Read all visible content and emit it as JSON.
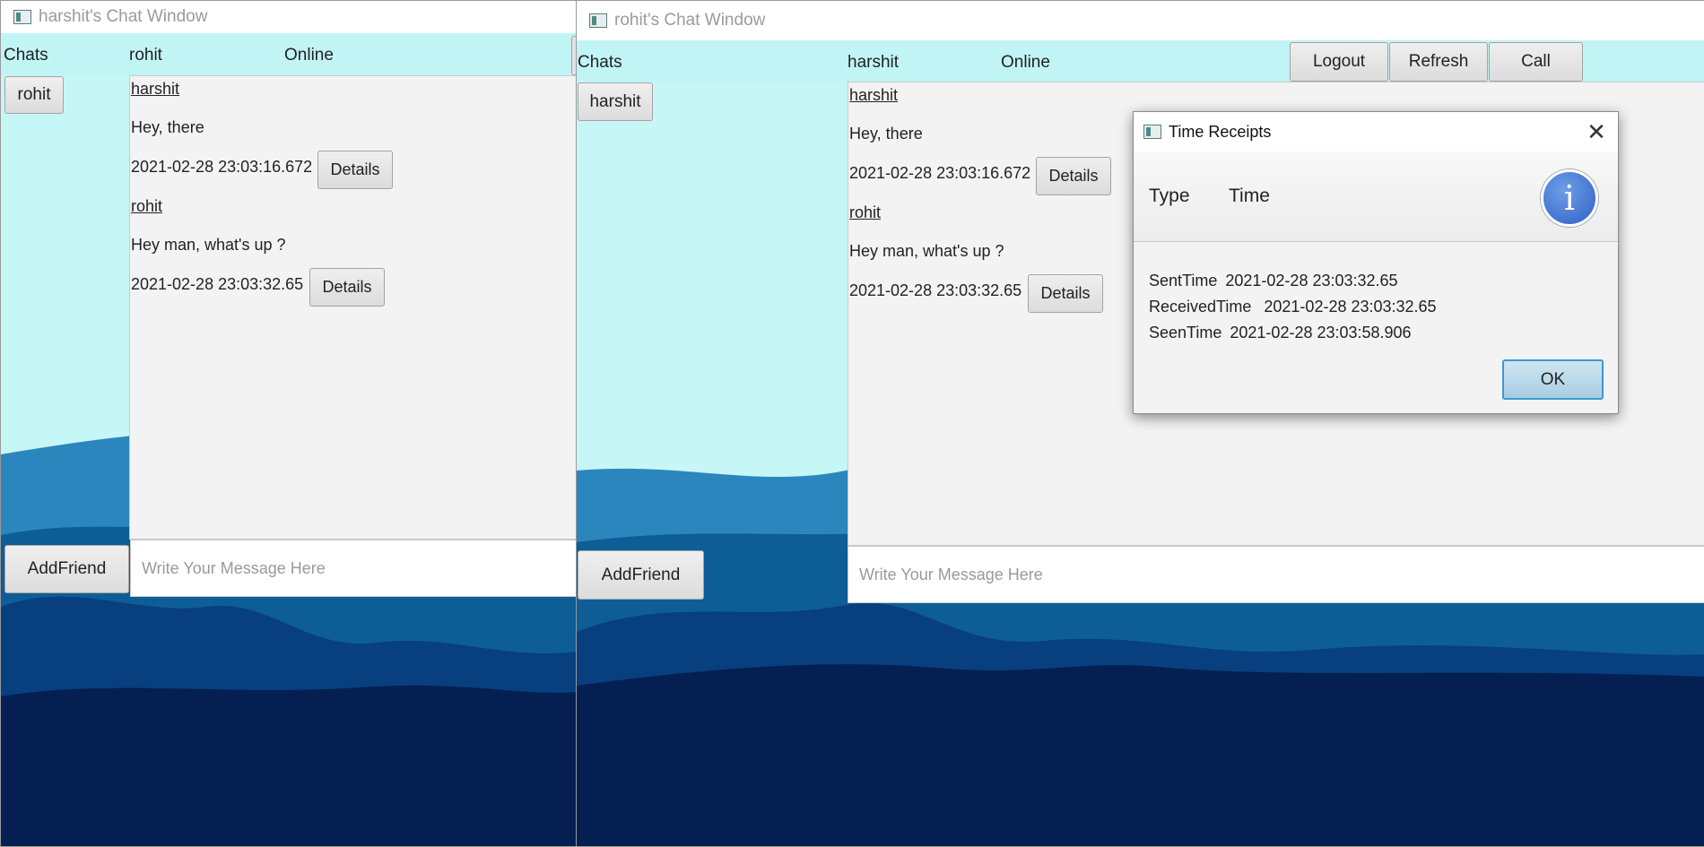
{
  "colors": {
    "header_bg": "#c1f4f5",
    "sky_top": "#c6f6f6",
    "mountain_light": "#2b86bd",
    "mountain_mid": "#0d5d96",
    "mountain_dark": "#062f66",
    "ok_border": "#3a98d4"
  },
  "window_left": {
    "title": "harshit's Chat Window",
    "header": {
      "chats_label": "Chats",
      "friend_name": "rohit",
      "status": "Online"
    },
    "friends": [
      "rohit"
    ],
    "messages": [
      {
        "sender": "harshit",
        "text": "Hey, there",
        "time": "2021-02-28 23:03:16.672",
        "details_label": "Details"
      },
      {
        "sender": "rohit",
        "text": "Hey man, what's up ?",
        "time": "2021-02-28 23:03:32.65",
        "details_label": "Details"
      }
    ],
    "add_friend_label": "AddFriend",
    "input_placeholder": "Write Your Message Here"
  },
  "window_right": {
    "title": "rohit's Chat Window",
    "header": {
      "chats_label": "Chats",
      "friend_name": "harshit",
      "status": "Online",
      "logout_label": "Logout",
      "refresh_label": "Refresh",
      "call_label": "Call"
    },
    "friends": [
      "harshit"
    ],
    "messages": [
      {
        "sender": "harshit",
        "text": "Hey, there",
        "time": "2021-02-28 23:03:16.672",
        "details_label": "Details"
      },
      {
        "sender": "rohit",
        "text": "Hey man, what's up ?",
        "time": "2021-02-28 23:03:32.65",
        "details_label": "Details"
      }
    ],
    "add_friend_label": "AddFriend",
    "input_placeholder": "Write Your Message Here"
  },
  "dialog": {
    "title": "Time Receipts",
    "header_col1": "Type",
    "header_col2": "Time",
    "rows": [
      {
        "type": "SentTime",
        "time": "2021-02-28 23:03:32.65"
      },
      {
        "type": "ReceivedTime",
        "time": " 2021-02-28 23:03:32.65"
      },
      {
        "type": "SeenTime",
        "time": "2021-02-28 23:03:58.906"
      }
    ],
    "ok_label": "OK",
    "info_glyph": "i"
  }
}
